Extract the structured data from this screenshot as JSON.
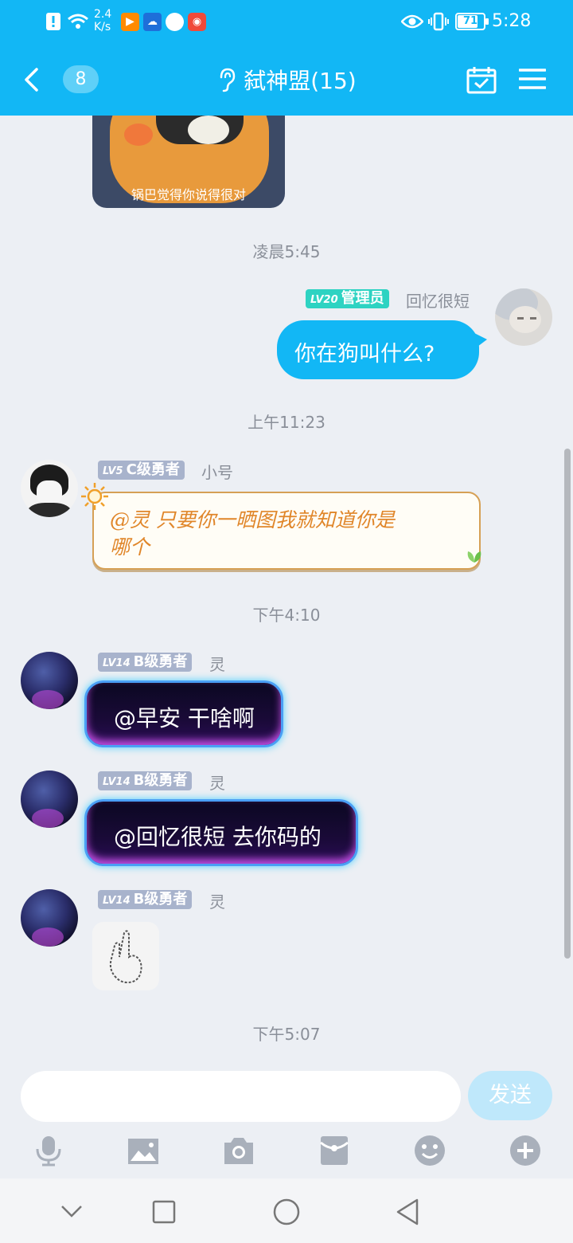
{
  "status_bar": {
    "net_speed_value": "2.4",
    "net_speed_unit": "K/s",
    "battery": "71",
    "time": "5:28",
    "icons": [
      "alert-icon",
      "wifi-icon",
      "video-app-icon",
      "weather-app-icon",
      "browser-app-icon",
      "radio-app-icon",
      "eye-icon",
      "vibrate-icon",
      "battery-icon"
    ]
  },
  "header": {
    "unread_count": "8",
    "title": "弑神盟(15)",
    "icons": [
      "back-icon",
      "ear-icon",
      "calendar-check-icon",
      "menu-icon"
    ]
  },
  "messages": {
    "sticker_caption": "锅巴觉得你说得很对",
    "time1": "凌晨5:45",
    "self_badge_lv": "LV20",
    "self_badge_title": "管理员",
    "self_name": "回忆很短",
    "self_text": "你在狗叫什么?",
    "time2": "上午11:23",
    "m1_badge_lv": "LV5",
    "m1_badge_title": "C级勇者",
    "m1_name": "小号",
    "m1_text_line1": "@灵 只要你一晒图我就知道你是",
    "m1_text_line2": "哪个",
    "time3": "下午4:10",
    "m2_badge_lv": "LV14",
    "m2_badge_title": "B级勇者",
    "m2_name": "灵",
    "m2_text": "@早安 干啥啊",
    "m3_badge_lv": "LV14",
    "m3_badge_title": "B级勇者",
    "m3_name": "灵",
    "m3_text": "@回忆很短 去你码的",
    "m4_badge_lv": "LV14",
    "m4_badge_title": "B级勇者",
    "m4_name": "灵",
    "time4": "下午5:07"
  },
  "input": {
    "placeholder": "",
    "send_label": "发送"
  },
  "toolbar": [
    "mic-icon",
    "image-icon",
    "camera-icon",
    "red-packet-icon",
    "emoji-icon",
    "plus-icon"
  ],
  "nav": [
    "nav-down-icon",
    "nav-recents-icon",
    "nav-home-icon",
    "nav-back-icon"
  ],
  "colors": {
    "accent": "#12b7f5",
    "background": "#eceff4",
    "badge_admin": "#2ed3c2",
    "badge_member": "#a8b3cc"
  }
}
